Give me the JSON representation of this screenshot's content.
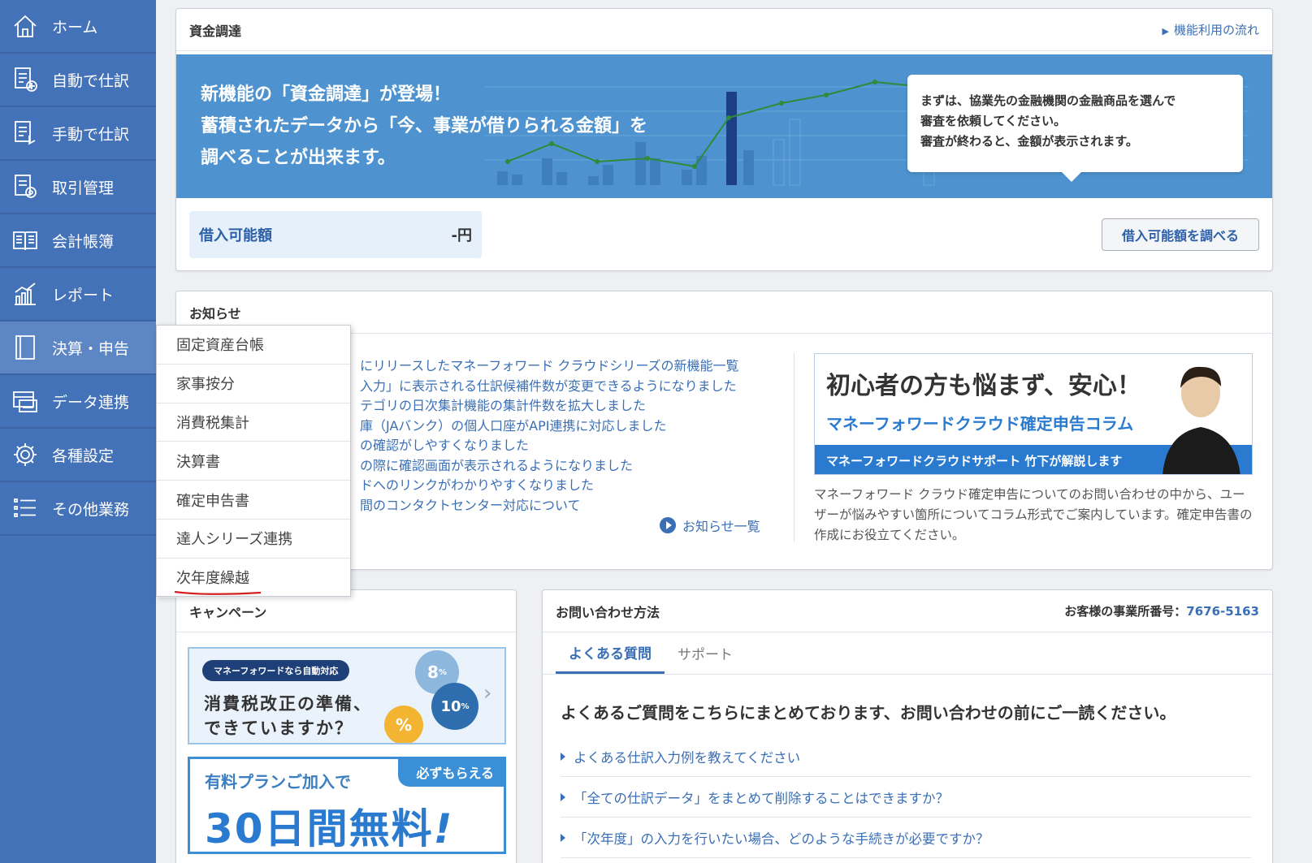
{
  "sidebar": {
    "items": [
      {
        "label": "ホーム",
        "icon": "home-icon"
      },
      {
        "label": "自動で仕訳",
        "icon": "auto-entry-icon"
      },
      {
        "label": "手動で仕訳",
        "icon": "manual-entry-icon"
      },
      {
        "label": "取引管理",
        "icon": "transactions-icon"
      },
      {
        "label": "会計帳簿",
        "icon": "ledger-book-icon"
      },
      {
        "label": "レポート",
        "icon": "report-chart-icon"
      },
      {
        "label": "決算・申告",
        "icon": "settlement-icon"
      },
      {
        "label": "データ連携",
        "icon": "data-link-icon"
      },
      {
        "label": "各種設定",
        "icon": "gear-icon"
      },
      {
        "label": "その他業務",
        "icon": "list-icon"
      }
    ]
  },
  "dropdown": {
    "items": [
      "固定資産台帳",
      "家事按分",
      "消費税集計",
      "決算書",
      "確定申告書",
      "達人シリーズ連携",
      "次年度繰越"
    ]
  },
  "finance": {
    "title": "資金調達",
    "flow_link": "機能利用の流れ",
    "banner_lines": [
      "新機能の「資金調達」が登場！",
      "蓄積されたデータから「今、事業が借りられる金額」を",
      "調べることが出来ます。"
    ],
    "bubble_lines": [
      "まずは、協業先の金融機関の金融商品を選んで",
      "審査を依頼してください。",
      "審査が終わると、金額が表示されます。"
    ],
    "borrow_label": "借入可能額",
    "borrow_value": "-円",
    "check_button": "借入可能額を調べる"
  },
  "news": {
    "title": "お知らせ",
    "items": [
      "にリリースしたマネーフォワード クラウドシリーズの新機能一覧",
      "入力」に表示される仕訳候補件数が変更できるようになりました",
      "テゴリの日次集計機能の集計件数を拡大しました",
      "庫（JAバンク）の個人口座がAPI連携に対応しました",
      "の確認がしやすくなりました",
      "の際に確認画面が表示されるようになりました",
      "ドへのリンクがわかりやすくなりました",
      "間のコンタクトセンター対応について"
    ],
    "more_link": "お知らせ一覧",
    "column": {
      "headline": "初心者の方も悩まず、安心！",
      "subtitle": "マネーフォワードクラウド確定申告コラム",
      "ribbon": "マネーフォワードクラウドサポート 竹下が解説します",
      "description": "マネーフォワード クラウド確定申告についてのお問い合わせの中から、ユーザーが悩みやすい箇所についてコラム形式でご案内しています。確定申告書の作成にお役立てください。"
    }
  },
  "campaign": {
    "title": "キャンペーン",
    "banner1": {
      "tag": "マネーフォワードなら自動対応",
      "line1": "消費税改正の準備、",
      "line2": "できていますか？",
      "rate1": "8",
      "rate2": "10",
      "unit": "%"
    },
    "banner2": {
      "line1": "有料プランご加入で",
      "badge": "必ずもらえる",
      "headline": "30日間無料",
      "mark": "!"
    }
  },
  "contact": {
    "title": "お問い合わせ方法",
    "office_label": "お客様の事業所番号：",
    "office_number": "7676-5163",
    "tabs": [
      {
        "label": "よくある質問",
        "active": true
      },
      {
        "label": "サポート",
        "active": false
      }
    ],
    "lead": "よくあるご質問をこちらにまとめております、お問い合わせの前にご一読ください。",
    "faqs": [
      "よくある仕訳入力例を教えてください",
      "「全ての仕訳データ」をまとめて削除することはできますか？",
      "「次年度」の入力を行いたい場合、どのような手続きが必要ですか？"
    ]
  },
  "colors": {
    "sidebar": "#4472b8",
    "accent": "#3a6fb5",
    "banner": "#4e93cf"
  }
}
